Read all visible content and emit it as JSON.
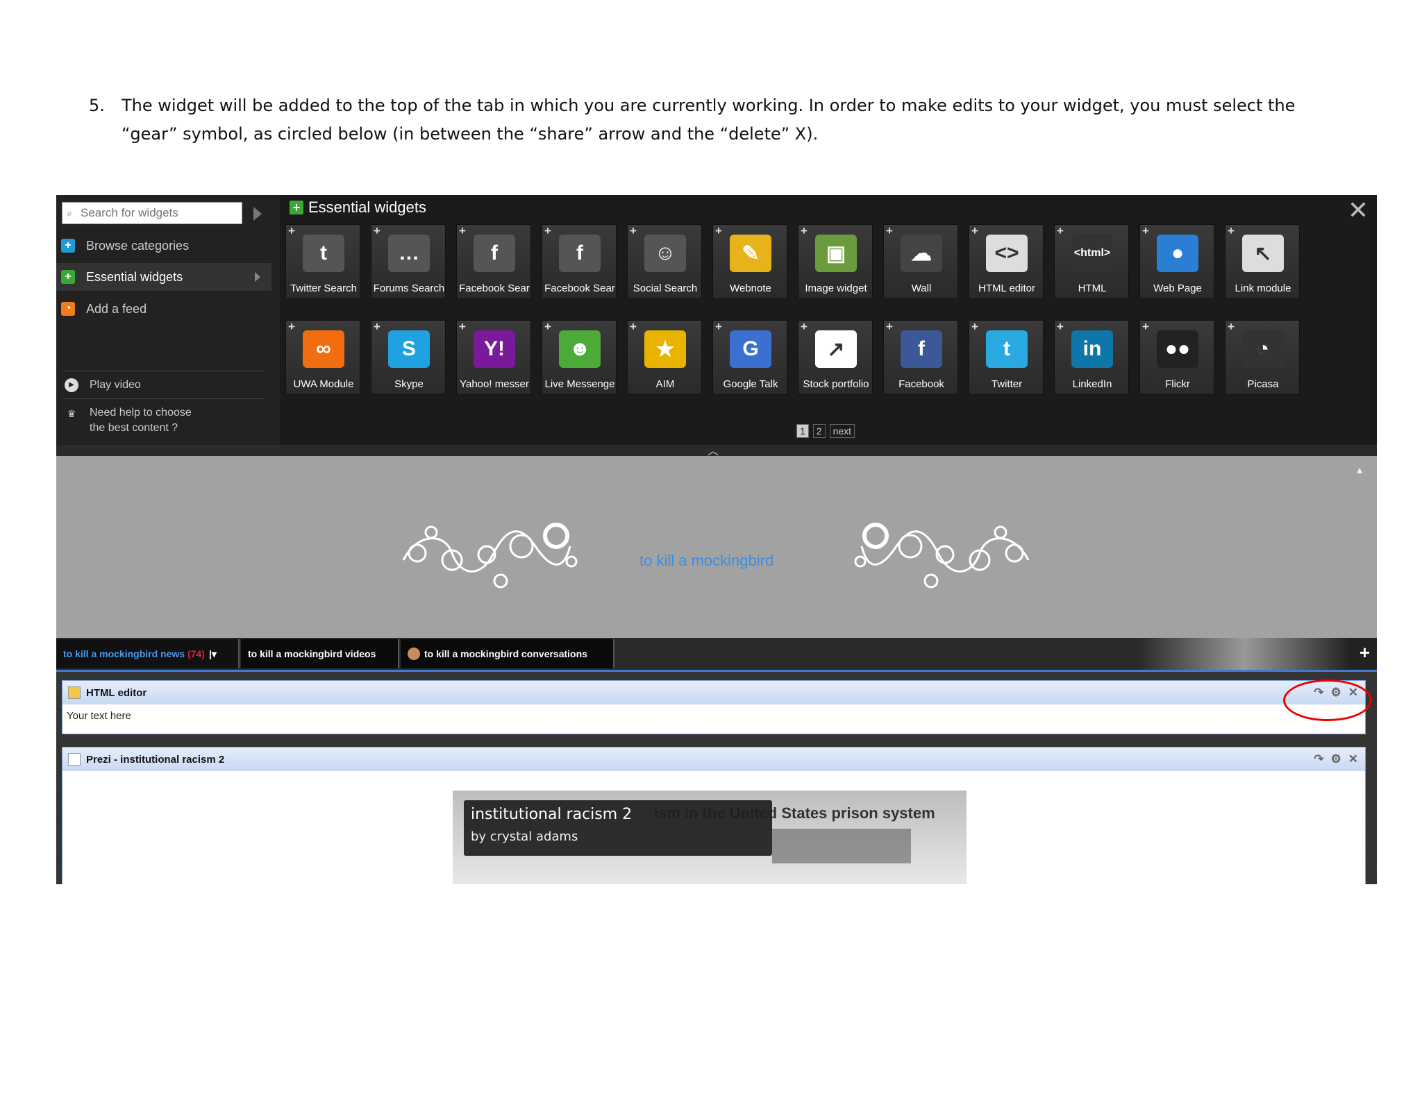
{
  "instruction": {
    "number": "5.",
    "text": "The widget will be added to the top of the tab in which you are currently working. In order to make edits to your widget, you must select the “gear” symbol, as circled below (in between the “share” arrow and the “delete” X)."
  },
  "sidebar": {
    "search_placeholder": "Search for widgets",
    "items": [
      {
        "label": "Browse categories"
      },
      {
        "label": "Essential widgets"
      },
      {
        "label": "Add a feed"
      }
    ],
    "play_video": "Play video",
    "help_line1": "Need help to choose",
    "help_line2": "the best content ?"
  },
  "panel": {
    "title": "Essential widgets",
    "row1": [
      {
        "label": "Twitter Search",
        "icon": "twitter-search-icon",
        "glyph": "t",
        "color": "#555555"
      },
      {
        "label": "Forums Search",
        "icon": "forums-search-icon",
        "glyph": "…",
        "color": "#555555"
      },
      {
        "label": "Facebook Sear",
        "icon": "facebook-search-icon",
        "glyph": "f",
        "color": "#555555"
      },
      {
        "label": "Facebook Sear",
        "icon": "facebook-social-search-icon",
        "glyph": "f",
        "color": "#555555"
      },
      {
        "label": "Social Search",
        "icon": "social-search-icon",
        "glyph": "☺",
        "color": "#555555"
      },
      {
        "label": "Webnote",
        "icon": "webnote-icon",
        "glyph": "✎",
        "color": "#e8b21a"
      },
      {
        "label": "Image widget",
        "icon": "image-widget-icon",
        "glyph": "▣",
        "color": "#6a9b3c"
      },
      {
        "label": "Wall",
        "icon": "wall-icon",
        "glyph": "☁",
        "color": "#444444"
      },
      {
        "label": "HTML editor",
        "icon": "html-editor-icon",
        "glyph": "<>",
        "color": "#dddddd"
      },
      {
        "label": "HTML",
        "icon": "html-icon",
        "glyph": "<html>",
        "color": "#333333"
      },
      {
        "label": "Web Page",
        "icon": "web-page-icon",
        "glyph": "●",
        "color": "#2a7fd4"
      },
      {
        "label": "Link module",
        "icon": "link-module-icon",
        "glyph": "↖",
        "color": "#dddddd"
      }
    ],
    "row2": [
      {
        "label": "UWA Module",
        "icon": "uwa-module-icon",
        "glyph": "∞",
        "color": "#f26d0f"
      },
      {
        "label": "Skype",
        "icon": "skype-icon",
        "glyph": "S",
        "color": "#1ea3e0"
      },
      {
        "label": "Yahoo! messer",
        "icon": "yahoo-messenger-icon",
        "glyph": "Y!",
        "color": "#7a1a9a"
      },
      {
        "label": "Live Messenge",
        "icon": "live-messenger-icon",
        "glyph": "☻",
        "color": "#4caa3a"
      },
      {
        "label": "AIM",
        "icon": "aim-icon",
        "glyph": "★",
        "color": "#e8b400"
      },
      {
        "label": "Google Talk",
        "icon": "google-talk-icon",
        "glyph": "G",
        "color": "#3b6fd0"
      },
      {
        "label": "Stock portfolio",
        "icon": "stock-portfolio-icon",
        "glyph": "↗",
        "color": "#ffffff"
      },
      {
        "label": "Facebook",
        "icon": "facebook-icon",
        "glyph": "f",
        "color": "#3b5998"
      },
      {
        "label": "Twitter",
        "icon": "twitter-icon",
        "glyph": "t",
        "color": "#2aa9e0"
      },
      {
        "label": "LinkedIn",
        "icon": "linkedin-icon",
        "glyph": "in",
        "color": "#0e76a8"
      },
      {
        "label": "Flickr",
        "icon": "flickr-icon",
        "glyph": "●●",
        "color": "#222222"
      },
      {
        "label": "Picasa",
        "icon": "picasa-icon",
        "glyph": "◔",
        "color": "#333333"
      }
    ],
    "pager": {
      "page1": "1",
      "page2": "2",
      "next": "next"
    }
  },
  "banner": {
    "title": "to kill a mockingbird"
  },
  "tabs": [
    {
      "label": "to kill a mockingbird news",
      "count": "(74)"
    },
    {
      "label": "to kill a mockingbird videos"
    },
    {
      "label": "to kill a mockingbird conversations"
    }
  ],
  "widgets": {
    "html_editor": {
      "title": "HTML editor",
      "body": "Your text here"
    },
    "prezi": {
      "title": "Prezi - institutional racism 2",
      "presentation_title": "institutional racism 2",
      "author": "by crystal adams",
      "background_title": "ism in the United States prison system"
    }
  },
  "colors": {
    "accent_blue": "#3b8fe3",
    "add_green": "#3aa835",
    "highlight_red": "#e00000"
  }
}
